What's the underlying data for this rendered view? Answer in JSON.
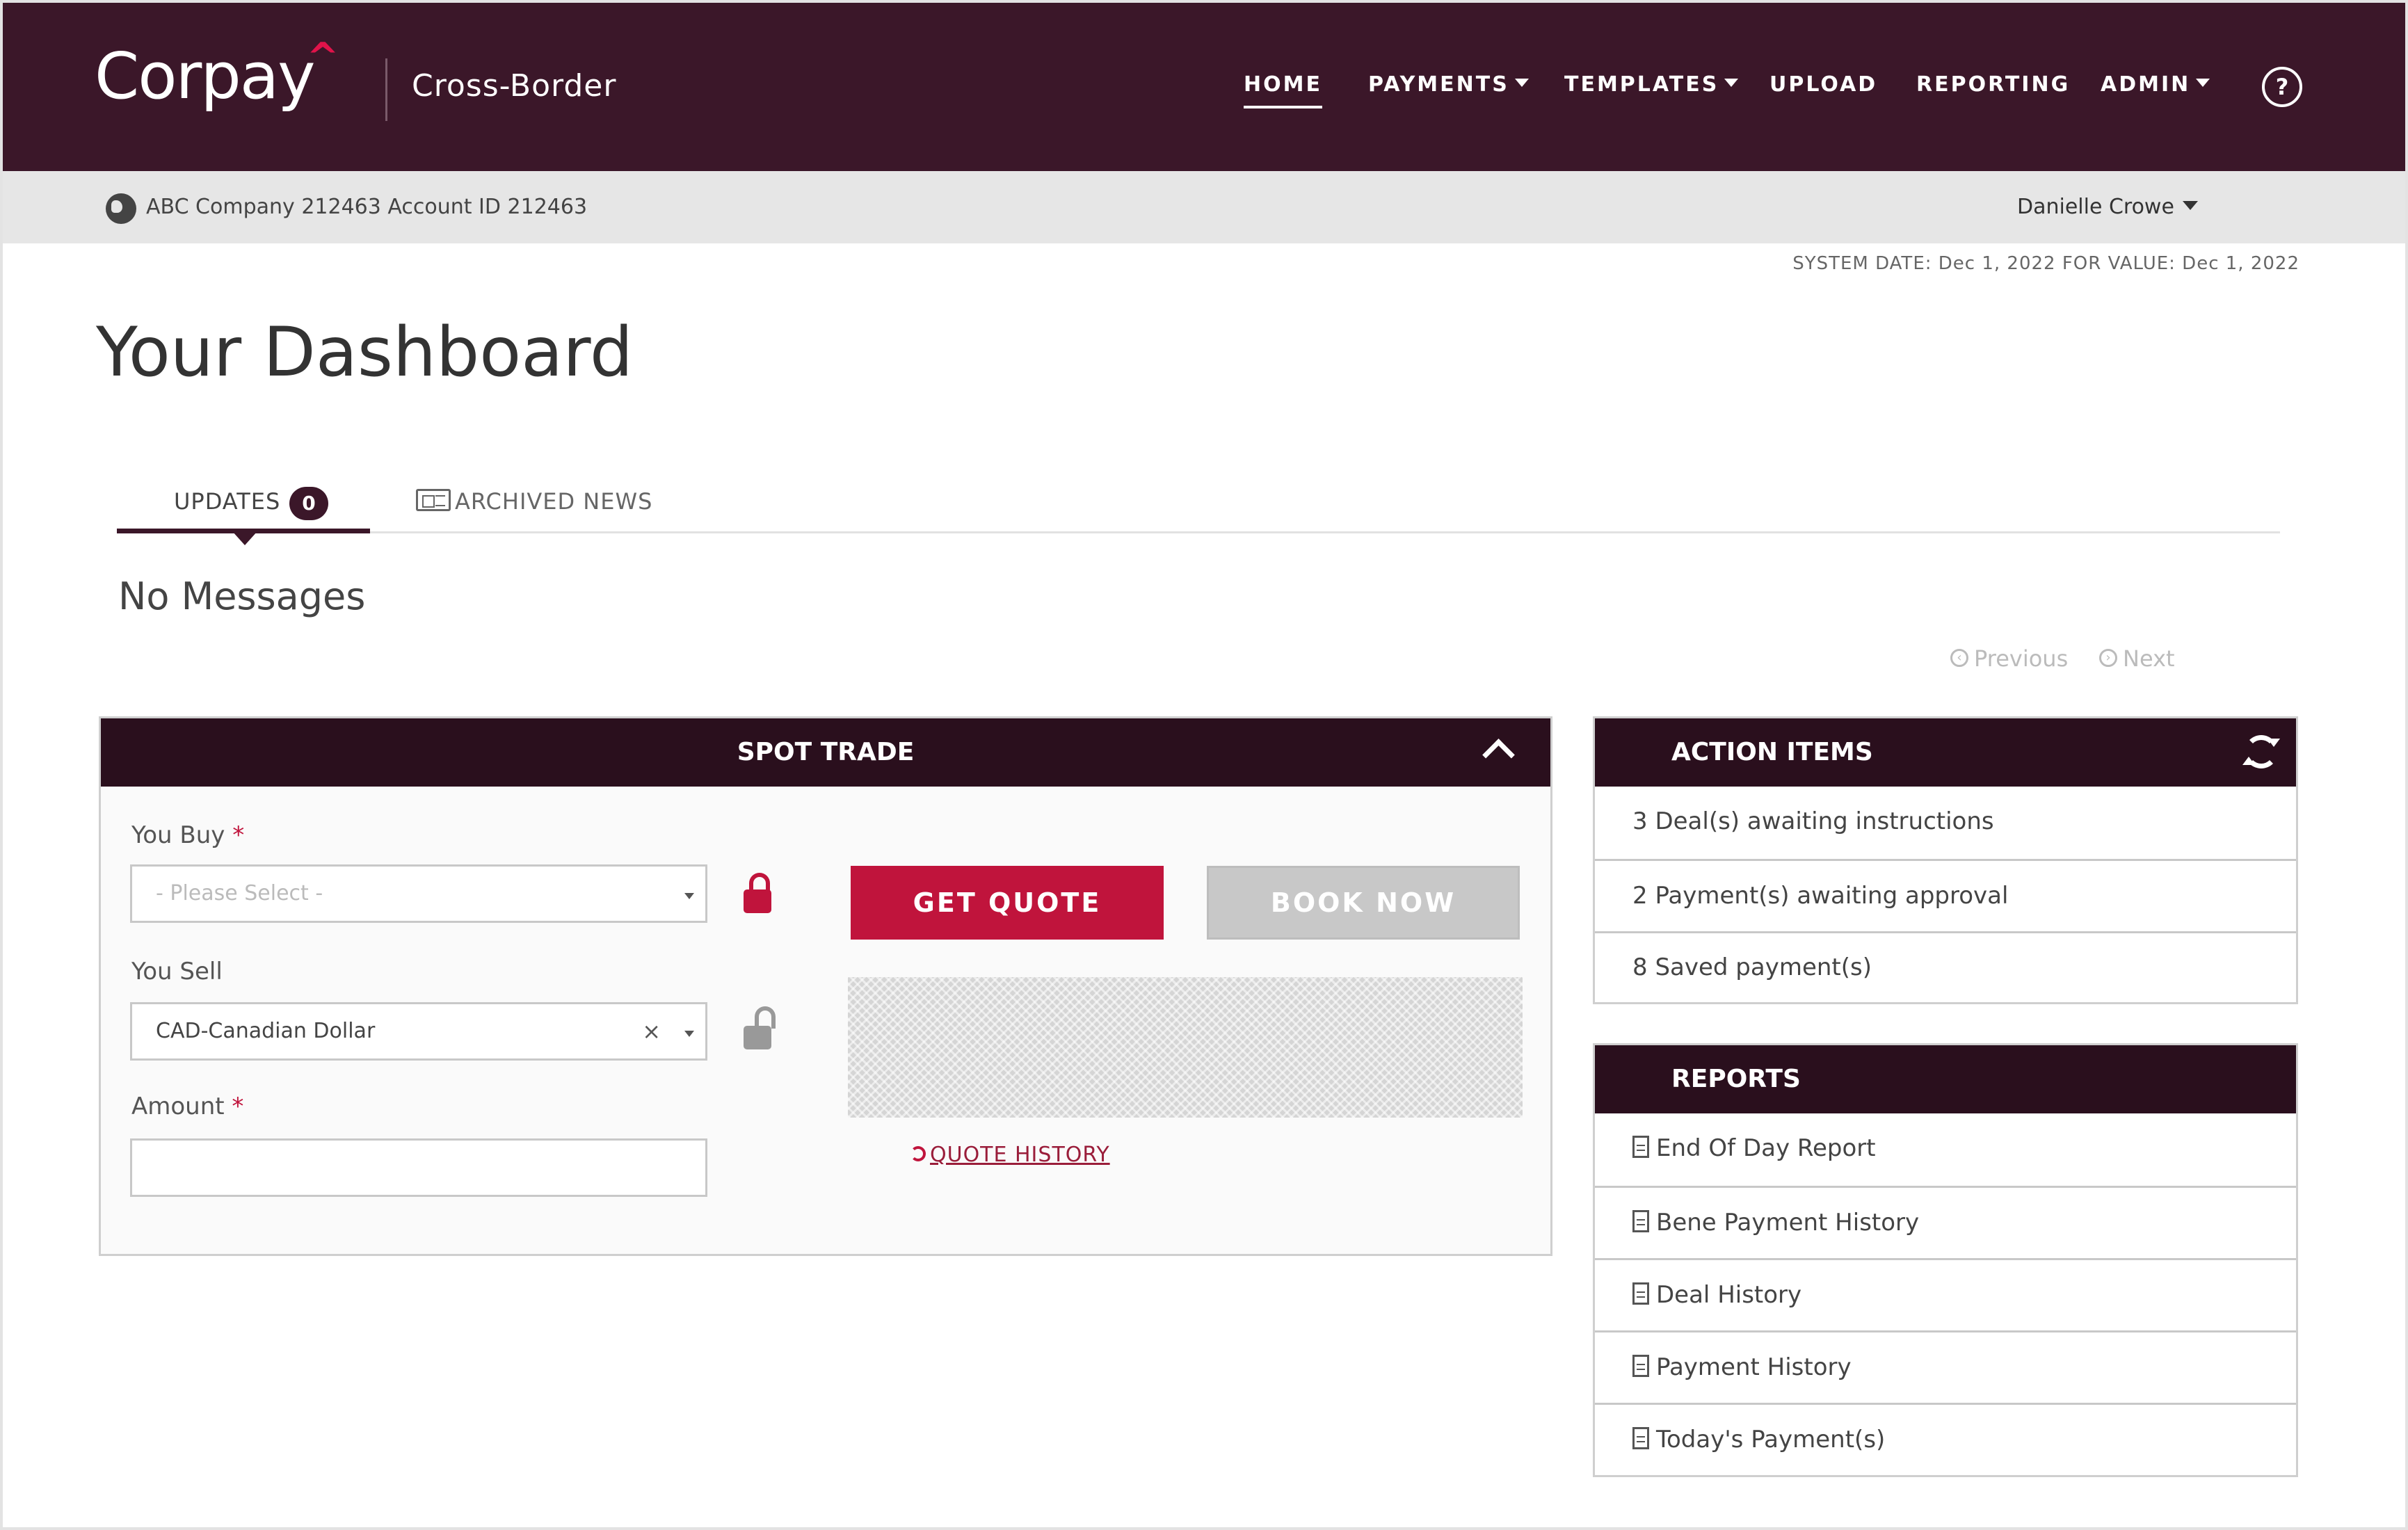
{
  "header": {
    "logo": "Corpay",
    "logo_caret": "^",
    "product": "Cross-Border",
    "nav": [
      {
        "label": "HOME",
        "dropdown": false,
        "active": true
      },
      {
        "label": "PAYMENTS",
        "dropdown": true
      },
      {
        "label": "TEMPLATES",
        "dropdown": true
      },
      {
        "label": "UPLOAD",
        "dropdown": false
      },
      {
        "label": "REPORTING",
        "dropdown": false
      },
      {
        "label": "ADMIN",
        "dropdown": true
      }
    ],
    "help": "?"
  },
  "subbar": {
    "account": "ABC Company 212463 Account ID 212463",
    "user": "Danielle Crowe"
  },
  "system_date": "SYSTEM DATE: Dec 1, 2022 FOR VALUE: Dec 1, 2022",
  "page_title": "Your Dashboard",
  "tabs": {
    "updates_label": "UPDATES",
    "updates_count": "0",
    "archived_label": "ARCHIVED NEWS"
  },
  "messages": "No Messages",
  "pager": {
    "previous": "Previous",
    "next": "Next"
  },
  "spot_trade": {
    "title": "SPOT TRADE",
    "you_buy_label": "You Buy",
    "you_buy_placeholder": "- Please Select -",
    "you_sell_label": "You Sell",
    "you_sell_value": "CAD-Canadian Dollar",
    "clear_symbol": "×",
    "amount_label": "Amount",
    "required_mark": "*",
    "get_quote": "GET QUOTE",
    "book_now": "BOOK NOW",
    "quote_history": "QUOTE HISTORY"
  },
  "action_items": {
    "title": "ACTION ITEMS",
    "items": [
      "3 Deal(s) awaiting instructions",
      "2 Payment(s) awaiting approval",
      "8 Saved payment(s)"
    ]
  },
  "reports": {
    "title": "REPORTS",
    "items": [
      "End Of Day Report",
      "Bene Payment History",
      "Deal History",
      "Payment History",
      "Today's Payment(s)"
    ]
  },
  "colors": {
    "brand": "#3b1729",
    "panel_header": "#2a0f1d",
    "accent_red": "#c0143c",
    "disabled_button": "#c8c8c8"
  }
}
